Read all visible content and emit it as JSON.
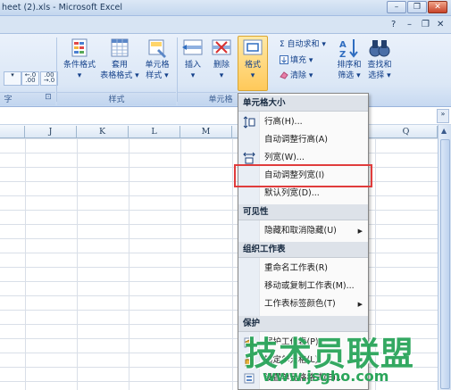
{
  "window": {
    "title": "heet (2).xls - Microsoft Excel",
    "minimize": "–",
    "restore": "❐",
    "close": "✕"
  },
  "ribbon_controls": {
    "help": "?",
    "min": "–",
    "restore": "❐",
    "close": "✕"
  },
  "number_group": {
    "increase_decimal": "←.0 .00",
    "decrease_decimal": ".00 →.0",
    "label": "字",
    "launcher": "⊡"
  },
  "styles_group": {
    "label": "样式",
    "buttons": [
      {
        "label_1": "条件格式",
        "label_2": "▾",
        "icon": "conditional-format-icon"
      },
      {
        "label_1": "套用",
        "label_2": "表格格式 ▾",
        "icon": "table-format-icon"
      },
      {
        "label_1": "单元格",
        "label_2": "样式 ▾",
        "icon": "cell-style-icon"
      }
    ]
  },
  "cells_group": {
    "label": "单元格",
    "insert": {
      "label_1": "插入",
      "label_2": "▾"
    },
    "delete": {
      "label_1": "删除",
      "label_2": "▾"
    },
    "format": {
      "label_1": "格式",
      "label_2": "▾"
    }
  },
  "editing_group": {
    "autosum": "Σ 自动求和 ▾",
    "fill": "填充 ▾",
    "clear": "清除 ▾",
    "sort": {
      "label_1": "排序和",
      "label_2": "筛选 ▾"
    },
    "find": {
      "label_1": "查找和",
      "label_2": "选择 ▾"
    }
  },
  "expander": "»",
  "columns": [
    "J",
    "K",
    "L",
    "M",
    "Q"
  ],
  "format_menu": {
    "sections": [
      {
        "title": "单元格大小",
        "items": [
          {
            "label": "行高(H)...",
            "icon": "row-height-icon"
          },
          {
            "label": "自动调整行高(A)",
            "icon": ""
          },
          {
            "label": "列宽(W)...",
            "icon": "column-width-icon"
          },
          {
            "label": "自动调整列宽(I)",
            "icon": ""
          },
          {
            "label": "默认列宽(D)...",
            "icon": ""
          }
        ]
      },
      {
        "title": "可见性",
        "items": [
          {
            "label": "隐藏和取消隐藏(U)",
            "submenu": true
          }
        ]
      },
      {
        "title": "组织工作表",
        "items": [
          {
            "label": "重命名工作表(R)"
          },
          {
            "label": "移动或复制工作表(M)..."
          },
          {
            "label": "工作表标签颜色(T)",
            "submenu": true
          }
        ]
      },
      {
        "title": "保护",
        "items": [
          {
            "label": "保护工作表(P)...",
            "icon": "protect-sheet-icon"
          },
          {
            "label": "锁定单元格(L)",
            "icon": "lock-cell-icon"
          },
          {
            "label": "设置单元格格式(E)...",
            "icon": "format-cells-icon"
          }
        ]
      }
    ],
    "submenu_arrow": "▶"
  },
  "watermark": {
    "logo": "技术员联盟",
    "url": "www.jsgho.com"
  },
  "colors": {
    "accent": "#15428b",
    "highlight_border": "#e03c3c",
    "watermark": "#2aa55a"
  }
}
